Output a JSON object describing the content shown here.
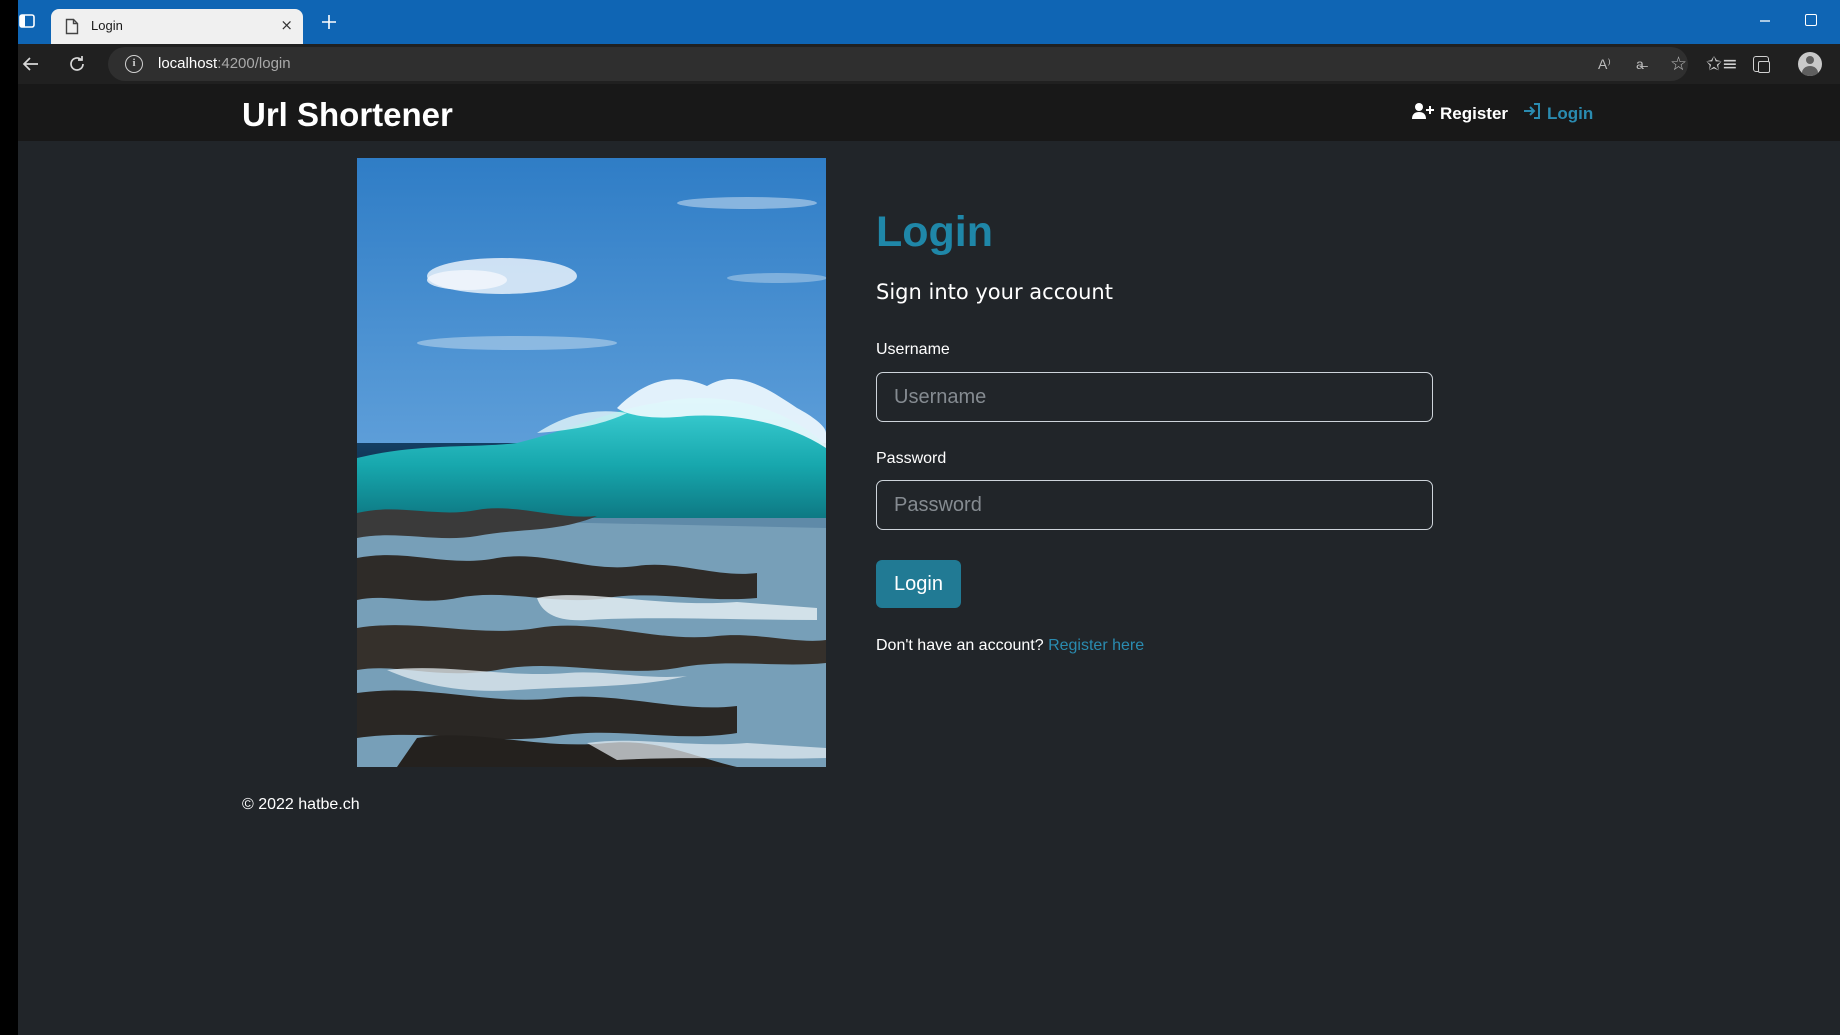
{
  "browser": {
    "tab_title": "Login",
    "tab_close": "×",
    "address_host": "localhost",
    "address_path": ":4200/login",
    "info_icon_glyph": "i",
    "read_aloud_icon": "A⁾",
    "translate_icon": "a̶",
    "add_favorite_icon": "☆",
    "favorites_icon": "✩≡"
  },
  "app": {
    "brand": "Url Shortener",
    "nav": {
      "register": "Register",
      "login": "Login"
    }
  },
  "login_form": {
    "title": "Login",
    "subtitle": "Sign into your account",
    "username_label": "Username",
    "username_placeholder": "Username",
    "password_label": "Password",
    "password_placeholder": "Password",
    "submit_label": "Login",
    "register_prompt": "Don't have an account?",
    "register_link": "Register here"
  },
  "footer": {
    "text": "© 2022 hatbe.ch"
  },
  "colors": {
    "page_background": "#212529",
    "header_background": "#181818",
    "accent": "#1f87a8",
    "button": "#217a94",
    "browser_titlebar": "#0f65b4"
  }
}
